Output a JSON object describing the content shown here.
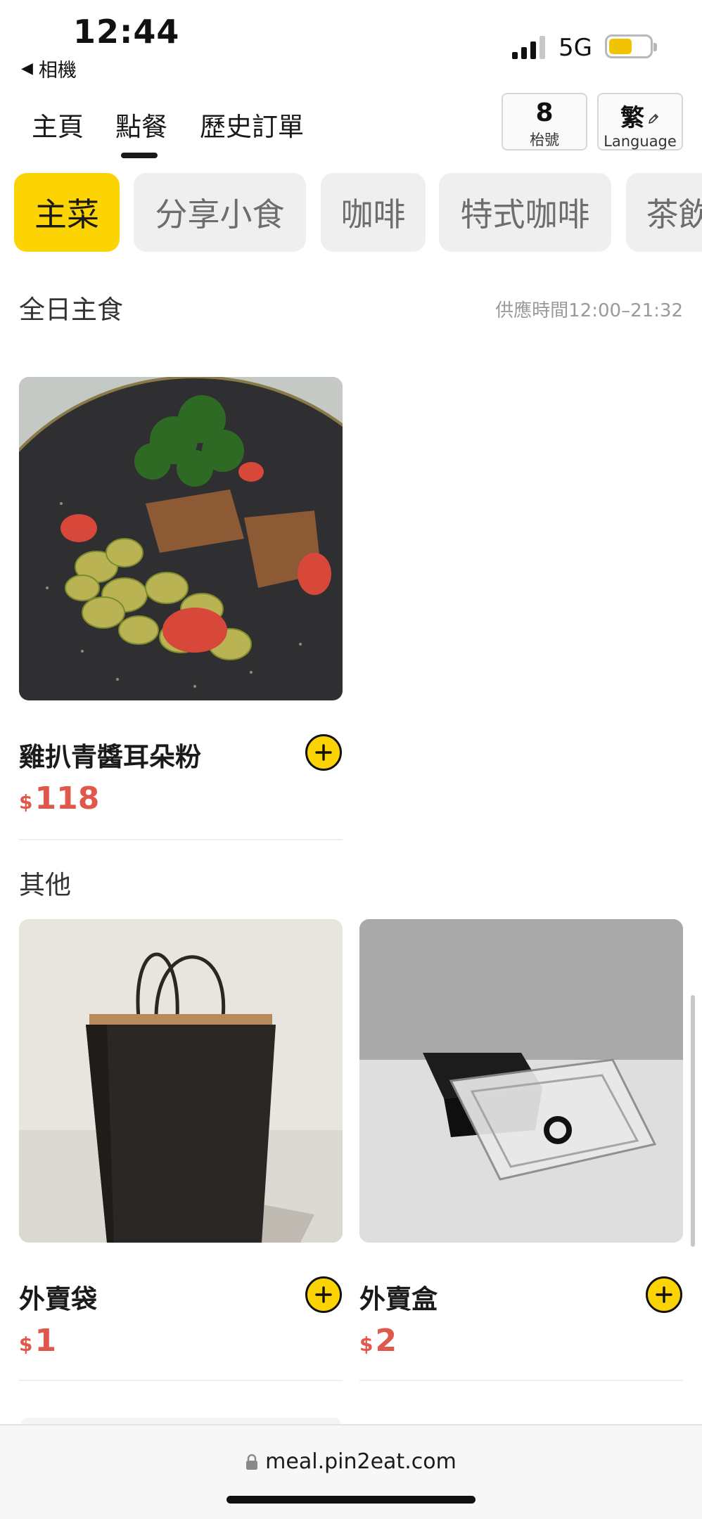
{
  "status_bar": {
    "time": "12:44",
    "back_app": "相機",
    "network": "5G",
    "battery_level": 0.58,
    "battery_color": "#f2c300"
  },
  "nav": {
    "tabs": [
      {
        "label": "主頁"
      },
      {
        "label": "點餐",
        "active": true
      },
      {
        "label": "歷史訂單"
      }
    ],
    "table_number": "8",
    "table_label": "枱號",
    "language_char": "繁",
    "language_label": "Language"
  },
  "categories": [
    {
      "label": "主菜",
      "active": true
    },
    {
      "label": "分享小食"
    },
    {
      "label": "咖啡"
    },
    {
      "label": "特式咖啡"
    },
    {
      "label": "茶飲"
    }
  ],
  "sections": [
    {
      "title": "全日主食",
      "serve_time": "供應時間12:00–21:32",
      "items": [
        {
          "name": "雞扒青醬耳朵粉",
          "currency": "$",
          "price": "118",
          "image": "pasta-photo"
        }
      ]
    },
    {
      "title": "其他",
      "items": [
        {
          "name": "外賣袋",
          "currency": "$",
          "price": "1",
          "image": "paper-bag-photo"
        },
        {
          "name": "外賣盒",
          "currency": "$",
          "price": "2",
          "image": "takeaway-box-photo"
        }
      ]
    }
  ],
  "browser": {
    "url": "meal.pin2eat.com"
  },
  "colors": {
    "accent": "#fcd303",
    "price": "#e0584b",
    "pill_inactive_bg": "#efefef",
    "pill_inactive_text": "#6d6d6d"
  }
}
